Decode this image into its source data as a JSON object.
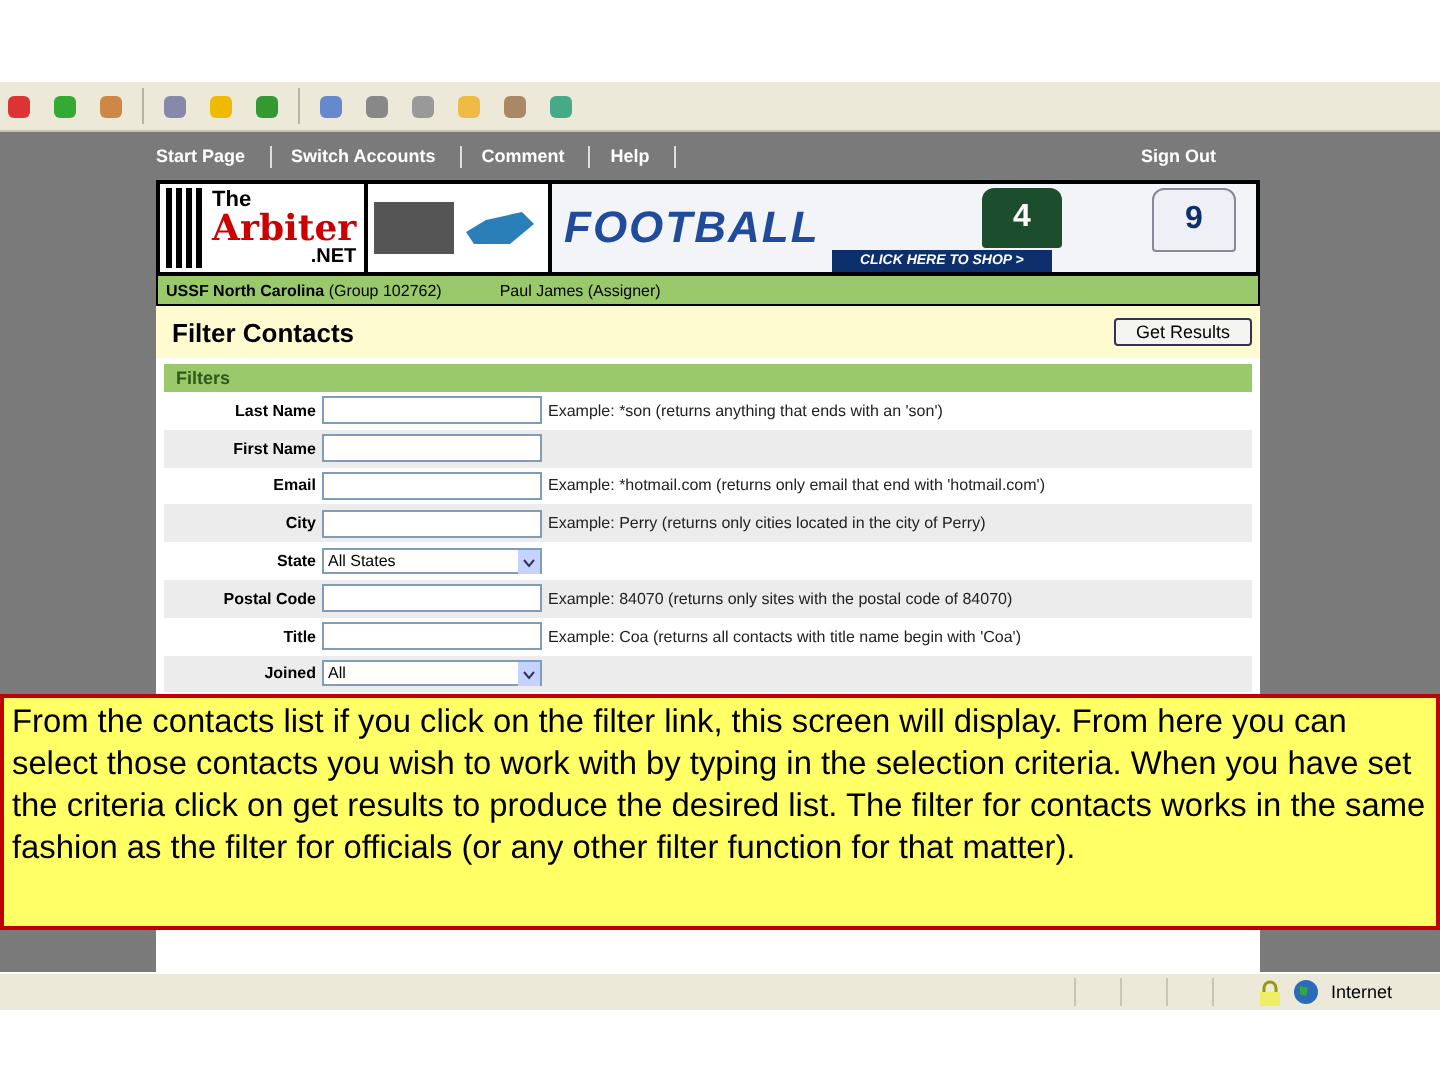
{
  "nav": {
    "links": [
      "Start Page",
      "Switch Accounts",
      "Comment",
      "Help"
    ],
    "sign_out": "Sign Out"
  },
  "banner": {
    "logo": [
      "The",
      "Arbiter",
      ".NET"
    ],
    "ad_title": "FOOTBALL",
    "ad_cta": "CLICK HERE TO SHOP >",
    "jerseys": [
      "4",
      "9"
    ]
  },
  "account_bar": {
    "org": "USSF North Carolina",
    "group": "(Group 102762)",
    "user": "Paul James (Assigner)"
  },
  "page": {
    "title": "Filter Contacts",
    "button": "Get Results",
    "section": "Filters"
  },
  "filters": [
    {
      "kind": "text",
      "label": "Last Name",
      "example": "Example: *son (returns anything that ends with an 'son')"
    },
    {
      "kind": "text",
      "label": "First Name"
    },
    {
      "kind": "text",
      "label": "Email",
      "example": "Example: *hotmail.com (returns only email that end with 'hotmail.com')"
    },
    {
      "kind": "text",
      "label": "City",
      "example": "Example: Perry (returns only cities located in the city of Perry)"
    },
    {
      "kind": "select",
      "label": "State",
      "value": "All States"
    },
    {
      "kind": "text",
      "label": "Postal Code",
      "example": "Example: 84070 (returns only sites with the postal code of 84070)"
    },
    {
      "kind": "text",
      "label": "Title",
      "example": "Example: Coa (returns all contacts with title name begin with 'Coa')"
    },
    {
      "kind": "select",
      "label": "Joined",
      "value": "All"
    }
  ],
  "callout": "From the contacts list if you click on the filter link, this screen will display.  From here you can select those contacts you wish to work with by typing in the selection criteria.  When you have set the criteria click on get results to produce the desired list.  The filter for contacts works in the same fashion as the filter for officials (or any other filter function for that matter).",
  "status_bar": {
    "zone": "Internet"
  }
}
